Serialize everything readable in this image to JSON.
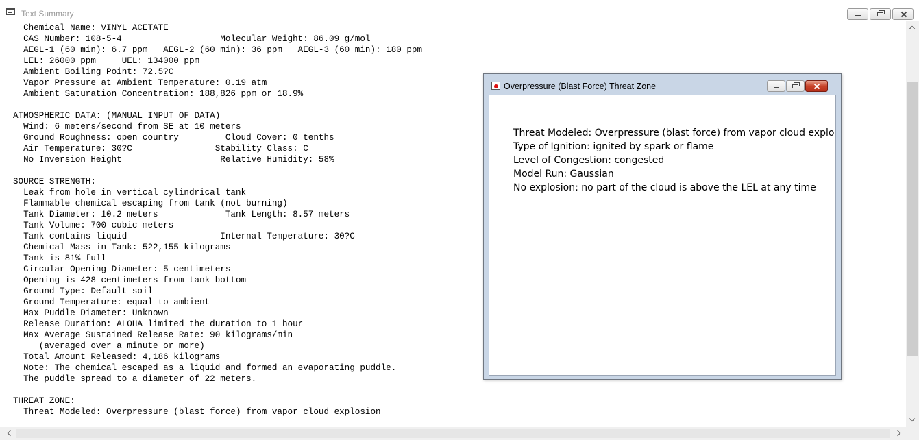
{
  "main_window": {
    "title": "Text Summary",
    "lines": [
      "  Chemical Name: VINYL ACETATE",
      "  CAS Number: 108-5-4                   Molecular Weight: 86.09 g/mol",
      "  AEGL-1 (60 min): 6.7 ppm   AEGL-2 (60 min): 36 ppm   AEGL-3 (60 min): 180 ppm",
      "  LEL: 26000 ppm     UEL: 134000 ppm",
      "  Ambient Boiling Point: 72.5?C",
      "  Vapor Pressure at Ambient Temperature: 0.19 atm",
      "  Ambient Saturation Concentration: 188,826 ppm or 18.9%",
      "",
      "ATMOSPHERIC DATA: (MANUAL INPUT OF DATA)",
      "  Wind: 6 meters/second from SE at 10 meters",
      "  Ground Roughness: open country         Cloud Cover: 0 tenths",
      "  Air Temperature: 30?C                Stability Class: C",
      "  No Inversion Height                   Relative Humidity: 58%",
      "",
      "SOURCE STRENGTH:",
      "  Leak from hole in vertical cylindrical tank",
      "  Flammable chemical escaping from tank (not burning)",
      "  Tank Diameter: 10.2 meters             Tank Length: 8.57 meters",
      "  Tank Volume: 700 cubic meters",
      "  Tank contains liquid                  Internal Temperature: 30?C",
      "  Chemical Mass in Tank: 522,155 kilograms",
      "  Tank is 81% full",
      "  Circular Opening Diameter: 5 centimeters",
      "  Opening is 428 centimeters from tank bottom",
      "  Ground Type: Default soil",
      "  Ground Temperature: equal to ambient",
      "  Max Puddle Diameter: Unknown",
      "  Release Duration: ALOHA limited the duration to 1 hour",
      "  Max Average Sustained Release Rate: 90 kilograms/min",
      "     (averaged over a minute or more)",
      "  Total Amount Released: 4,186 kilograms",
      "  Note: The chemical escaped as a liquid and formed an evaporating puddle.",
      "  The puddle spread to a diameter of 22 meters.",
      "",
      "THREAT ZONE:",
      "  Threat Modeled: Overpressure (blast force) from vapor cloud explosion"
    ]
  },
  "threat_window": {
    "title": "Overpressure (Blast Force) Threat Zone",
    "lines": [
      "Threat Modeled: Overpressure (blast force) from vapor cloud explosion",
      "Type of Ignition: ignited by spark or flame",
      "Level of Congestion: congested",
      "Model Run: Gaussian",
      "No explosion: no part of the cloud is above the LEL at any time"
    ]
  },
  "icons": {
    "main_window_icon": "text-document-icon",
    "threat_window_icon": "threat-zone-icon",
    "minimize": "minimize-icon",
    "maximize": "maximize-icon",
    "close": "close-icon"
  },
  "colors": {
    "close_button": "#c8442a",
    "dialog_frame": "#c9d6e6",
    "inactive_title_text": "#9a9a9a"
  }
}
